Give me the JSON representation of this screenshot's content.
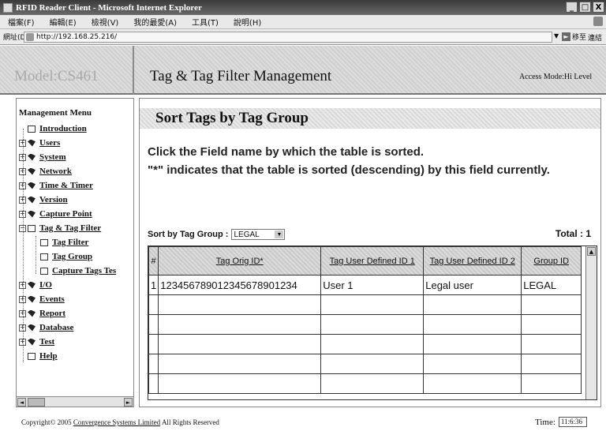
{
  "window": {
    "title": "RFID Reader Client - Microsoft Internet Explorer",
    "buttons": [
      "_",
      "□",
      "X"
    ]
  },
  "menubar": {
    "items": [
      "檔案(F)",
      "編輯(E)",
      "檢視(V)",
      "我的最愛(A)",
      "工具(T)",
      "說明(H)"
    ]
  },
  "addressbar": {
    "label": "網址(D)",
    "url": "http://192.168.25.216/",
    "go_label": "移至",
    "links_label": "連結"
  },
  "header": {
    "model": "Model:CS461",
    "title": "Tag & Tag Filter Management",
    "access_mode": "Access Mode:Hi Level"
  },
  "sidebar": {
    "heading": "Management Menu",
    "items": [
      {
        "label": "Introduction",
        "icon": "page-icon"
      },
      {
        "label": "Users",
        "icon": "folder-icon"
      },
      {
        "label": "System",
        "icon": "folder-icon"
      },
      {
        "label": "Network",
        "icon": "folder-icon"
      },
      {
        "label": "Time & Timer",
        "icon": "folder-icon"
      },
      {
        "label": "Version",
        "icon": "folder-icon"
      },
      {
        "label": "Capture Point",
        "icon": "folder-icon"
      },
      {
        "label": "Tag & Tag Filter",
        "icon": "open-folder-icon"
      },
      {
        "label": "Tag Filter",
        "icon": "page-icon"
      },
      {
        "label": "Tag Group",
        "icon": "page-icon"
      },
      {
        "label": "Capture Tags Tes",
        "icon": "page-icon"
      },
      {
        "label": "I/O",
        "icon": "folder-icon"
      },
      {
        "label": "Events",
        "icon": "folder-icon"
      },
      {
        "label": "Report",
        "icon": "folder-icon"
      },
      {
        "label": "Database",
        "icon": "folder-icon"
      },
      {
        "label": "Test",
        "icon": "folder-icon"
      },
      {
        "label": "Help",
        "icon": "page-icon"
      }
    ]
  },
  "main": {
    "section_title": "Sort Tags by Tag Group",
    "instruction_1": "Click the Field name by which the table is sorted.",
    "instruction_2": "\"*\" indicates that the table is sorted (descending) by this field currently.",
    "sort_label": "Sort by Tag Group :",
    "sort_value": "LEGAL",
    "total": "Total : 1",
    "table": {
      "columns": [
        "#",
        "Tag Orig ID*",
        "Tag User Defined ID 1",
        "Tag User Defined ID 2",
        "Group ID"
      ],
      "rows": [
        [
          "1",
          "123456789012345678901234",
          "User 1",
          "Legal user",
          "LEGAL"
        ]
      ]
    }
  },
  "footer": {
    "copyright_prefix": "Copyright© 2005",
    "company": "Convergence Systems Limited",
    "copyright_suffix": "All Rights Reserved",
    "time_label": "Time:",
    "time_value": "11:6:36"
  }
}
